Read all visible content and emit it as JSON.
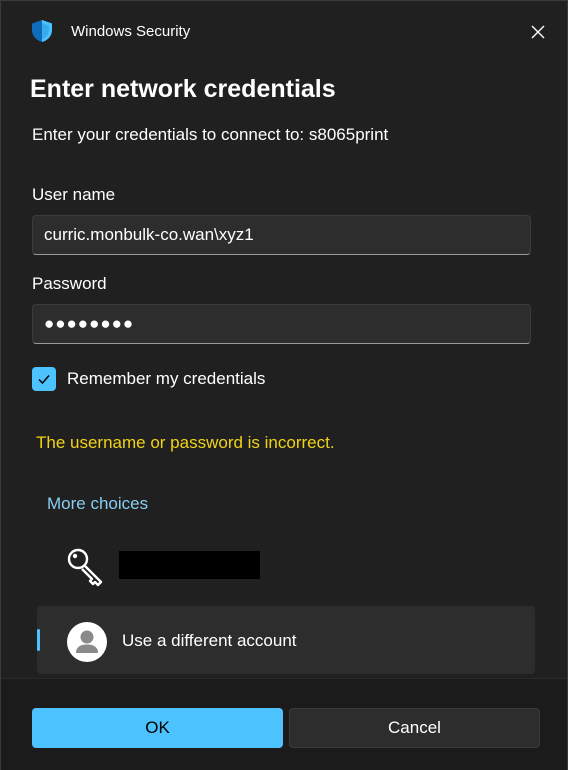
{
  "window": {
    "title": "Windows Security",
    "icon": "shield-icon",
    "accent": "#4cc2ff"
  },
  "dialog": {
    "heading": "Enter network credentials",
    "subtitle": "Enter your credentials to connect to: s8065print"
  },
  "username": {
    "label": "User name",
    "value": "curric.monbulk-co.wan\\xyz1"
  },
  "password": {
    "label": "Password",
    "masked_value": "●●●●●●●●"
  },
  "remember": {
    "label": "Remember my credentials",
    "checked": true
  },
  "error": {
    "text": "The username or password is incorrect.",
    "color": "#f2d316"
  },
  "choices": {
    "link_text": "More choices",
    "accounts": [
      {
        "icon": "key-icon",
        "label_redacted": true
      },
      {
        "icon": "user-avatar-icon",
        "label": "Use a different account",
        "selected": true
      }
    ]
  },
  "buttons": {
    "ok": "OK",
    "cancel": "Cancel"
  }
}
